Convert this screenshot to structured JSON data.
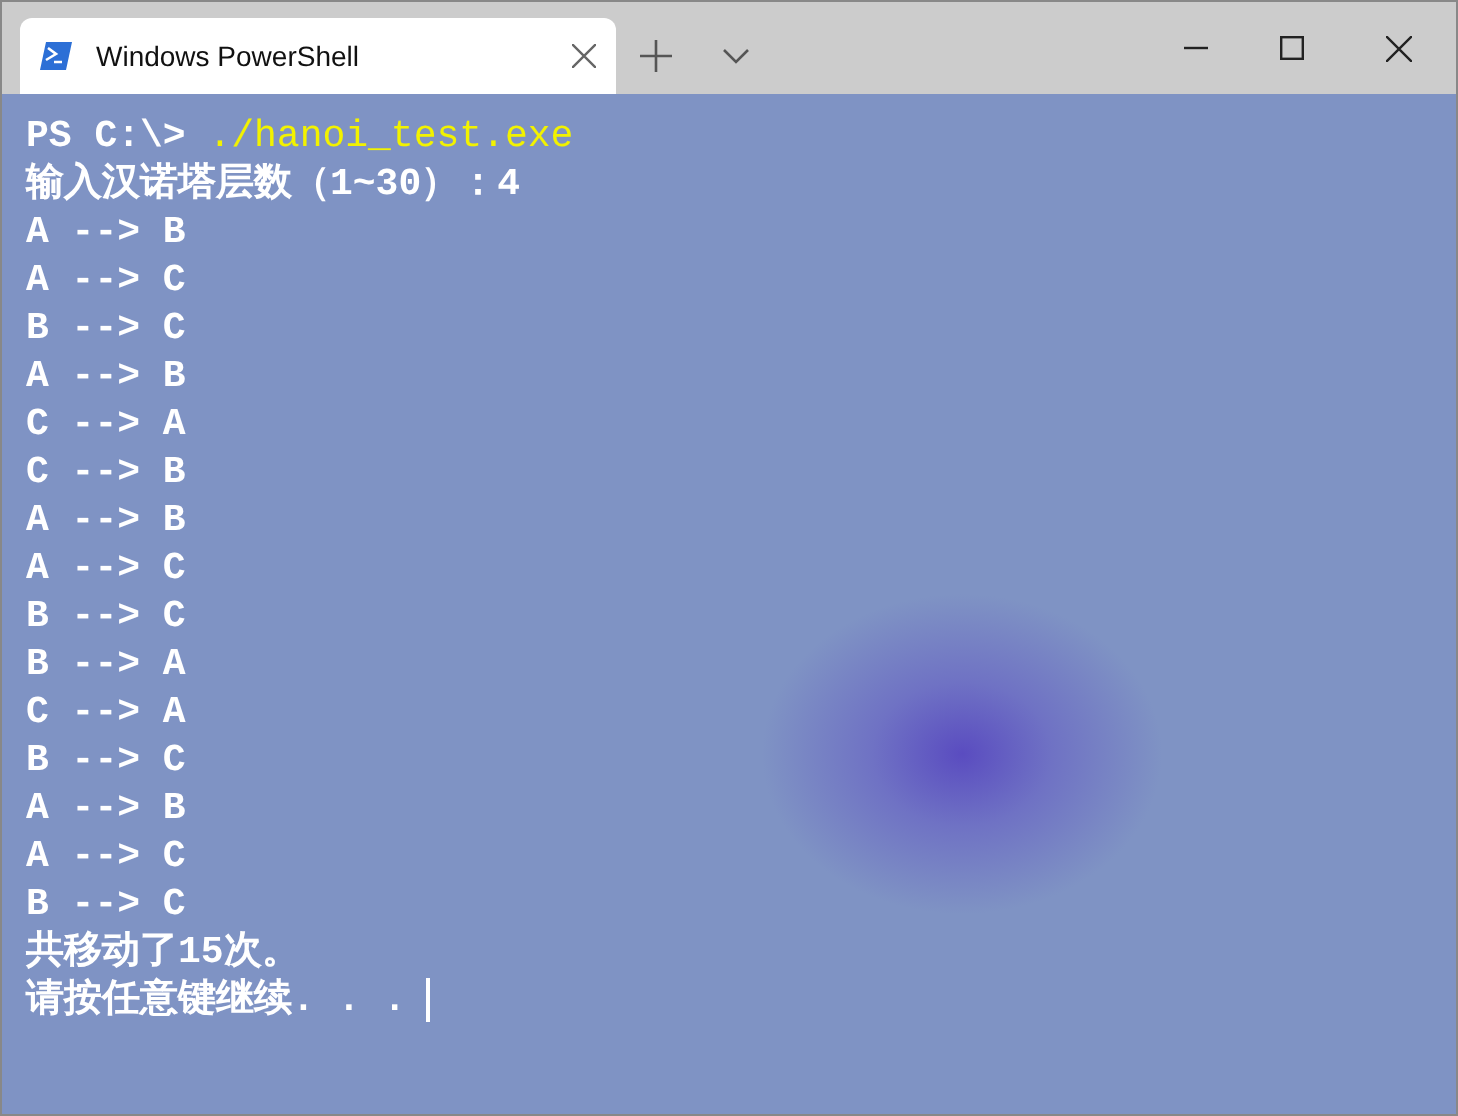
{
  "window": {
    "tabs": [
      {
        "title": "Windows PowerShell",
        "selected": true
      }
    ]
  },
  "terminal": {
    "prompt": "PS C:\\>",
    "command": "./hanoi_test.exe",
    "lines": [
      "输入汉诺塔层数（1~30）：4",
      "A --> B",
      "A --> C",
      "B --> C",
      "A --> B",
      "C --> A",
      "C --> B",
      "A --> B",
      "A --> C",
      "B --> C",
      "B --> A",
      "C --> A",
      "B --> C",
      "A --> B",
      "A --> C",
      "B --> C",
      "共移动了15次。",
      "请按任意键继续. . ."
    ],
    "cursor": true
  }
}
